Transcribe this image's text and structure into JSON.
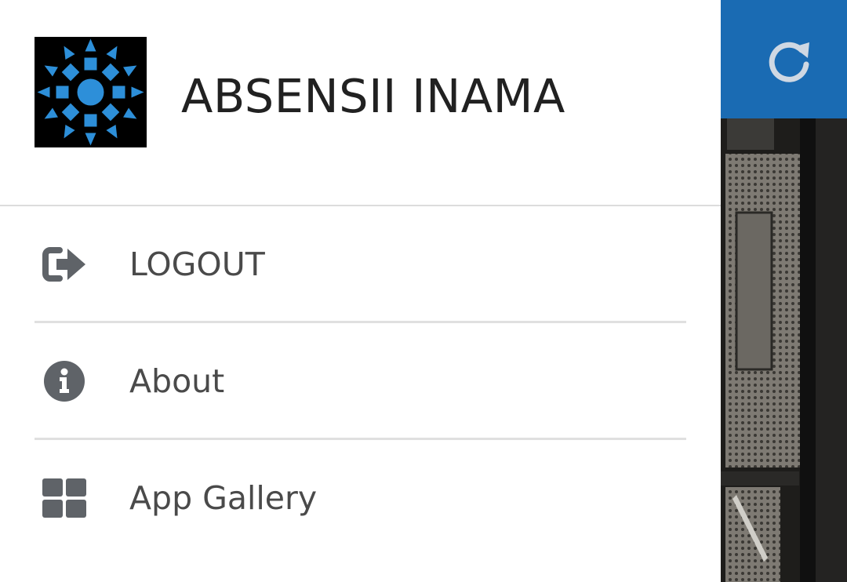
{
  "header": {
    "app_title": "ABSENSII INAMA",
    "logo_icon": "sun-logo-icon",
    "logo_colors": {
      "background": "#000000",
      "shapes": "#2d8fd9"
    }
  },
  "menu": {
    "items": [
      {
        "label": "LOGOUT",
        "icon": "logout-icon"
      },
      {
        "label": "About",
        "icon": "info-icon"
      },
      {
        "label": "App Gallery",
        "icon": "grid-icon"
      }
    ],
    "icon_color": "#5f6368",
    "label_color": "#4a4a4a"
  },
  "toolbar": {
    "refresh_icon": "refresh-icon",
    "color": "#1a6bb3"
  }
}
